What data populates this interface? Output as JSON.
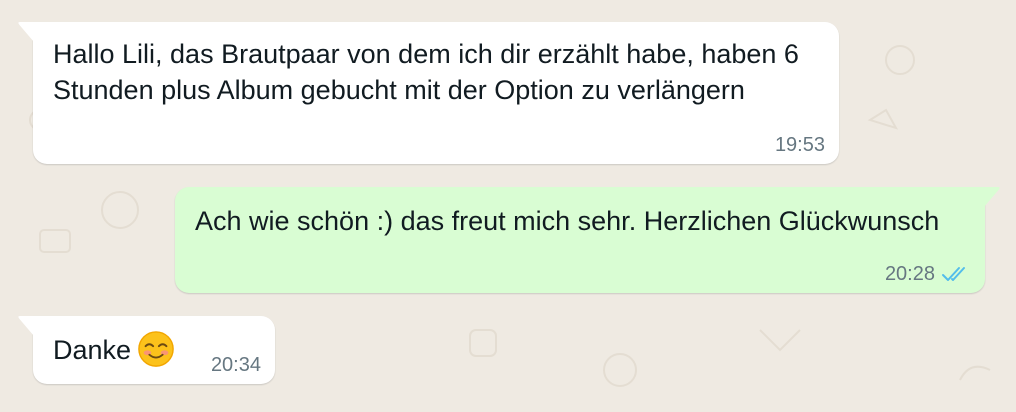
{
  "chat": {
    "messages": [
      {
        "direction": "incoming",
        "text": "Hallo Lili, das Brautpaar von dem ich dir erzählt habe, haben 6 Stunden plus Album gebucht mit der Option zu verlängern",
        "time": "19:53"
      },
      {
        "direction": "outgoing",
        "text": "Ach wie schön :) das freut mich sehr. Herzlichen Glückwunsch",
        "time": "20:28",
        "status": "read",
        "status_icon": "double-check-icon"
      },
      {
        "direction": "incoming",
        "text": "Danke",
        "emoji": "smiling-face-emoji",
        "time": "20:34"
      }
    ]
  },
  "colors": {
    "background": "#efeae2",
    "incoming_bubble": "#ffffff",
    "outgoing_bubble": "#d9fdd3",
    "text": "#111b21",
    "timestamp": "#667781",
    "read_ticks": "#53bdeb"
  }
}
